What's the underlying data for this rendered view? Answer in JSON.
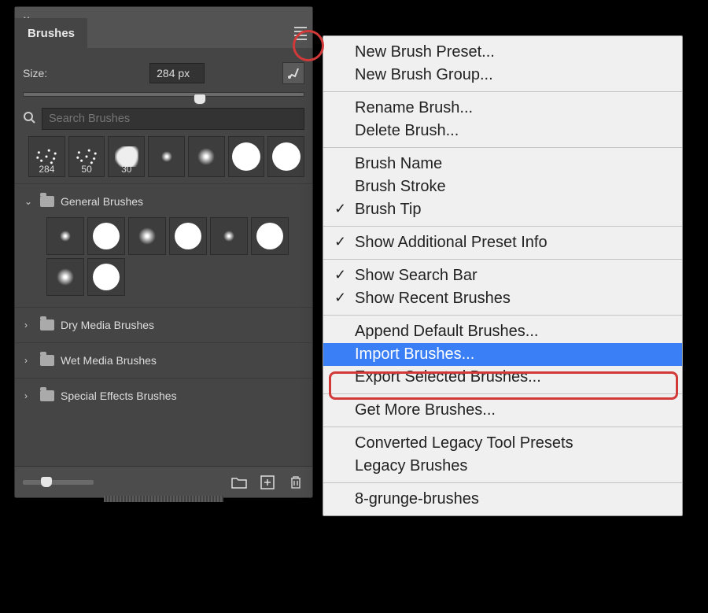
{
  "panel": {
    "tab_title": "Brushes",
    "size_label": "Size:",
    "size_value": "284 px",
    "search_placeholder": "Search Brushes",
    "recent_brushes": [
      {
        "label": "284",
        "shape": "scatter"
      },
      {
        "label": "50",
        "shape": "scatter"
      },
      {
        "label": "30",
        "shape": "cloud"
      },
      {
        "label": "",
        "shape": "soft-small"
      },
      {
        "label": "",
        "shape": "soft-med"
      },
      {
        "label": "",
        "shape": "hard-large"
      },
      {
        "label": "",
        "shape": "hard-large"
      }
    ],
    "groups": [
      {
        "name": "General Brushes",
        "expanded": true
      },
      {
        "name": "Dry Media Brushes",
        "expanded": false
      },
      {
        "name": "Wet Media Brushes",
        "expanded": false
      },
      {
        "name": "Special Effects Brushes",
        "expanded": false
      }
    ]
  },
  "menu": {
    "items": [
      {
        "label": "New Brush Preset...",
        "checked": false
      },
      {
        "label": "New Brush Group...",
        "checked": false
      },
      {
        "sep": true
      },
      {
        "label": "Rename Brush...",
        "checked": false
      },
      {
        "label": "Delete Brush...",
        "checked": false
      },
      {
        "sep": true
      },
      {
        "label": "Brush Name",
        "checked": false
      },
      {
        "label": "Brush Stroke",
        "checked": false
      },
      {
        "label": "Brush Tip",
        "checked": true
      },
      {
        "sep": true
      },
      {
        "label": "Show Additional Preset Info",
        "checked": true
      },
      {
        "sep": true
      },
      {
        "label": "Show Search Bar",
        "checked": true
      },
      {
        "label": "Show Recent Brushes",
        "checked": true
      },
      {
        "sep": true
      },
      {
        "label": "Append Default Brushes...",
        "checked": false
      },
      {
        "label": "Import Brushes...",
        "checked": false,
        "highlight": true
      },
      {
        "label": "Export Selected Brushes...",
        "checked": false
      },
      {
        "sep": true
      },
      {
        "label": "Get More Brushes...",
        "checked": false
      },
      {
        "sep": true
      },
      {
        "label": "Converted Legacy Tool Presets",
        "checked": false
      },
      {
        "label": "Legacy Brushes",
        "checked": false
      },
      {
        "sep": true
      },
      {
        "label": "8-grunge-brushes",
        "checked": false
      }
    ]
  }
}
